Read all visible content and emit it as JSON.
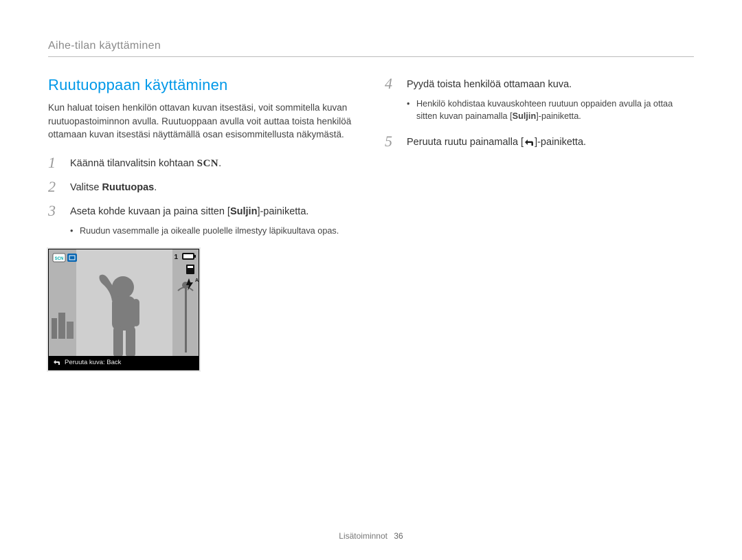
{
  "breadcrumb": "Aihe-tilan käyttäminen",
  "section_title": "Ruutuoppaan käyttäminen",
  "intro": "Kun haluat toisen henkilön ottavan kuvan itsestäsi, voit sommitella kuvan ruutuopastoiminnon avulla. Ruutuoppaan avulla voit auttaa toista henkilöä ottamaan kuvan itsestäsi näyttämällä osan esisommitellusta näkymästä.",
  "steps_left": {
    "s1_num": "1",
    "s1_prefix": "Käännä tilanvalitsin kohtaan ",
    "s1_scn": "SCN",
    "s1_suffix": ".",
    "s2_num": "2",
    "s2_prefix": "Valitse ",
    "s2_bold": "Ruutuopas",
    "s2_suffix": ".",
    "s3_num": "3",
    "s3_prefix": "Aseta kohde kuvaan ja paina sitten [",
    "s3_bold": "Suljin",
    "s3_suffix": "]-painiketta.",
    "s3_bullet": "Ruudun vasemmalle ja oikealle puolelle ilmestyy läpikuultava opas."
  },
  "steps_right": {
    "s4_num": "4",
    "s4_text": "Pyydä toista henkilöä ottamaan kuva.",
    "s4_bullet_prefix": "Henkilö kohdistaa kuvauskohteen ruutuun oppaiden avulla ja ottaa sitten kuvan painamalla [",
    "s4_bullet_bold": "Suljin",
    "s4_bullet_suffix": "]-painiketta.",
    "s5_num": "5",
    "s5_prefix": "Peruuta ruutu painamalla [",
    "s5_suffix": "]-painiketta."
  },
  "camera_screen": {
    "shots_remaining": "1",
    "caption": "Peruuta kuva: Back"
  },
  "footer": {
    "section": "Lisätoiminnot",
    "page": "36"
  },
  "icons": {
    "return": "return-icon",
    "battery": "battery-icon",
    "storage": "storage-icon",
    "flash": "flash-auto-icon",
    "scn_mode": "scn-mode-icon",
    "frame_guide": "frame-guide-icon"
  }
}
